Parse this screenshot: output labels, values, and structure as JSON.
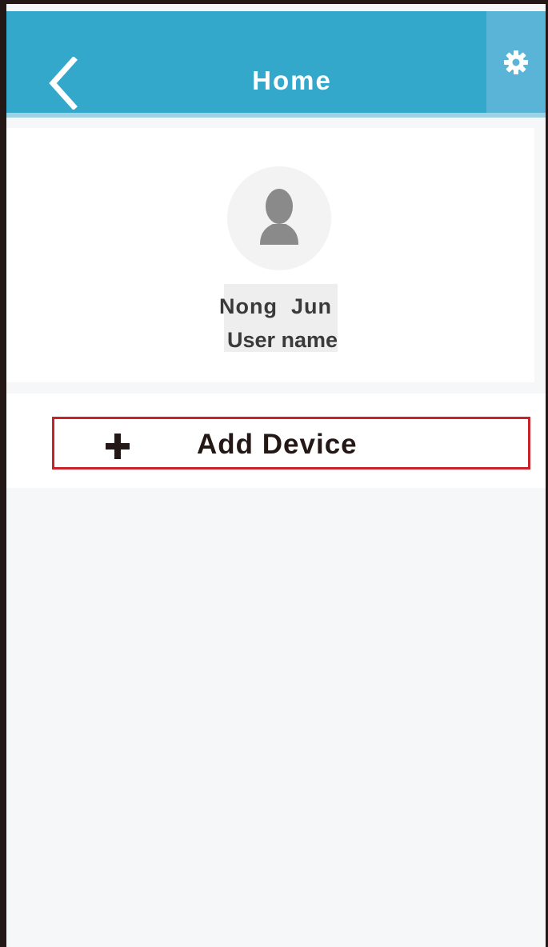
{
  "header": {
    "title": "Home",
    "back_icon": "chevron-left-icon",
    "settings_icon": "gear-icon",
    "background_color": "#33a8cb"
  },
  "profile": {
    "avatar_icon": "user-silhouette-icon",
    "name": "Nong  Jun",
    "name_label": "User name"
  },
  "actions": {
    "add_device_label": "Add Device",
    "add_icon": "plus-icon",
    "highlight_color": "#c8222a"
  }
}
